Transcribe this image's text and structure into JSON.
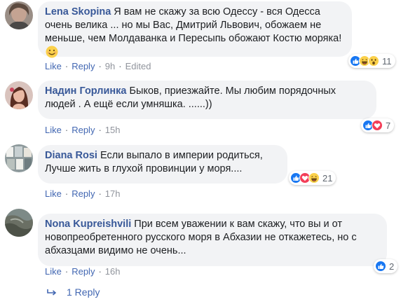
{
  "comments": [
    {
      "author": "Lena Skopina",
      "text": "Я вам не скажу за всю Одессу - вся Одесса очень велика ... но мы Вас, Дмитрий Львович, обожаем не меньше, чем Молдаванка и Пересыпь обожают Костю моряка!",
      "emoji": "smile-emoji",
      "like": "Like",
      "reply": "Reply",
      "time": "9h",
      "edited": "Edited",
      "reactions": [
        "like-reaction-icon",
        "haha-reaction-icon",
        "wow-reaction-icon"
      ],
      "reaction_count": "11"
    },
    {
      "author": "Надин Горлинка",
      "text": "Быков, приезжайте. Мы любим порядочных людей . А ещё если умняшка. ......))",
      "like": "Like",
      "reply": "Reply",
      "time": "15h",
      "reactions": [
        "like-reaction-icon",
        "love-reaction-icon"
      ],
      "reaction_count": "7"
    },
    {
      "author": "Diana Rosi",
      "text": "Если выпало в империи родиться, Лучше жить в глухой провинции у моря....",
      "like": "Like",
      "reply": "Reply",
      "time": "17h",
      "reactions": [
        "like-reaction-icon",
        "love-reaction-icon",
        "haha-reaction-icon"
      ],
      "reaction_count": "21"
    },
    {
      "author": "Nona Kupreishvili",
      "text": "При всем уважении к вам скажу, что вы и от новопреобретенного русского моря в Абхазии не откажетесь, но с абхазцами видимо не очень...",
      "like": "Like",
      "reply": "Reply",
      "time": "16h",
      "reactions": [
        "like-reaction-icon"
      ],
      "reaction_count": "2"
    }
  ],
  "replies_link": "1 Reply",
  "colors": {
    "author": "#385898",
    "link": "#4267b2",
    "bubble": "#f2f3f5",
    "meta": "#90949c",
    "like_blue": "#1877f2",
    "love_red": "#f33e58",
    "haha_yellow": "#fbd14b"
  }
}
